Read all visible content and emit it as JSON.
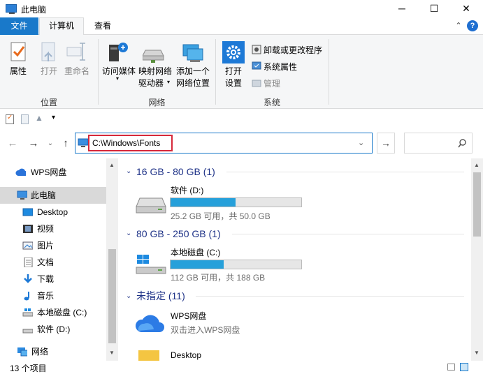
{
  "window": {
    "title": "此电脑",
    "minimize": "─",
    "maximize": "☐",
    "close": "✕"
  },
  "ribbon_tabs": {
    "file": "文件",
    "computer": "计算机",
    "view": "查看"
  },
  "ribbon": {
    "properties": "属性",
    "open": "打开",
    "rename": "重命名",
    "access_media": "访问媒体",
    "map_drive_1": "映射网络",
    "map_drive_2": "驱动器",
    "add_location_1": "添加一个",
    "add_location_2": "网络位置",
    "open_settings_1": "打开",
    "open_settings_2": "设置",
    "uninstall": "卸载或更改程序",
    "sys_props": "系统属性",
    "manage": "管理",
    "group_location": "位置",
    "group_network": "网络",
    "group_system": "系统"
  },
  "address": {
    "path": "C:\\Windows\\Fonts"
  },
  "nav": {
    "items": [
      {
        "label": "WPS网盘"
      },
      {
        "label": "此电脑"
      },
      {
        "label": "Desktop"
      },
      {
        "label": "视频"
      },
      {
        "label": "图片"
      },
      {
        "label": "文档"
      },
      {
        "label": "下载"
      },
      {
        "label": "音乐"
      },
      {
        "label": "本地磁盘 (C:)"
      },
      {
        "label": "软件 (D:)"
      },
      {
        "label": "网络"
      }
    ]
  },
  "groups": [
    {
      "header": "16 GB - 80 GB (1)"
    },
    {
      "header": "80 GB - 250 GB (1)"
    },
    {
      "header": "未指定 (11)"
    }
  ],
  "drives": [
    {
      "name": "软件 (D:)",
      "info": "25.2 GB 可用，共 50.0 GB",
      "used_fraction": 0.496
    },
    {
      "name": "本地磁盘 (C:)",
      "info": "112 GB 可用，共 188 GB",
      "used_fraction": 0.404
    }
  ],
  "unspecified": [
    {
      "name": "WPS网盘",
      "sub": "双击进入WPS网盘"
    },
    {
      "name": "Desktop"
    }
  ],
  "status": {
    "count": "13 个项目"
  },
  "colors": {
    "accent": "#1979ca",
    "bar": "#26a0da",
    "highlight": "#d6283a"
  }
}
